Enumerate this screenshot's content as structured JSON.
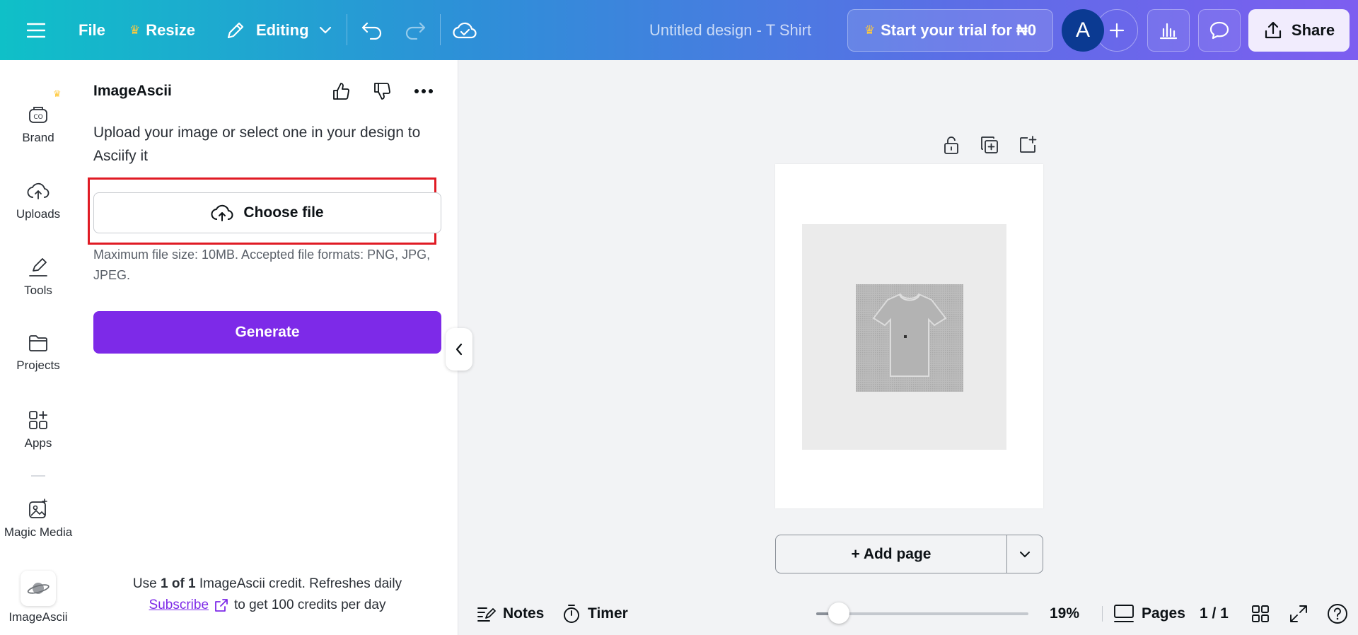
{
  "topbar": {
    "file": "File",
    "resize": "Resize",
    "editing": "Editing",
    "title": "Untitled design - T Shirt",
    "trial": "Start your trial for ₦0",
    "avatar_letter": "A",
    "share": "Share",
    "gradient_start": "#0fc0c8",
    "gradient_end": "#7d5ef0"
  },
  "rail": {
    "items": [
      {
        "label": "Brand",
        "icon": "brand-icon"
      },
      {
        "label": "Uploads",
        "icon": "cloud-upload-icon"
      },
      {
        "label": "Tools",
        "icon": "pen-tool-icon"
      },
      {
        "label": "Projects",
        "icon": "folder-icon"
      },
      {
        "label": "Apps",
        "icon": "apps-grid-icon"
      },
      {
        "label": "Magic Media",
        "icon": "magic-media-icon"
      },
      {
        "label": "ImageAscii",
        "icon": "planet-icon"
      }
    ]
  },
  "panel": {
    "title": "ImageAscii",
    "description": "Upload your image or select one in your design to Asciify it",
    "choose_file": "Choose file",
    "file_help": "Maximum file size: 10MB. Accepted file formats: PNG, JPG, JPEG.",
    "generate": "Generate",
    "credit_prefix": "Use ",
    "credit_count": "1 of 1",
    "credit_suffix": " ImageAscii credit. Refreshes daily",
    "subscribe": "Subscribe",
    "subscribe_suffix": "to get 100 credits per day",
    "accent_color": "#7d2ae8",
    "highlight_color": "#e01b24"
  },
  "canvas": {
    "add_page": "+ Add page"
  },
  "bottombar": {
    "notes": "Notes",
    "timer": "Timer",
    "zoom": "19%",
    "zoom_fraction": 0.19,
    "pages": "Pages",
    "page_count": "1 / 1"
  }
}
